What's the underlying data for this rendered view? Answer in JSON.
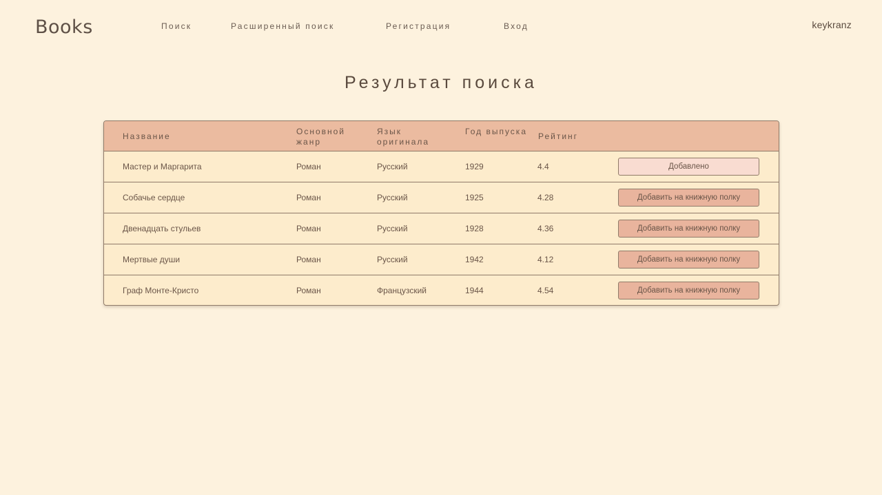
{
  "header": {
    "logo": "Books",
    "nav": {
      "search": "Поиск",
      "advanced_search": "Расширенный поиск",
      "register": "Регистрация",
      "login": "Вход"
    },
    "user": "keykranz"
  },
  "main": {
    "title": "Результат поиска"
  },
  "table": {
    "columns": {
      "name": "Название",
      "genre": "Основной жанр",
      "language": "Язык оригинала",
      "year": "Год выпуска",
      "rating": "Рейтинг"
    },
    "rows": [
      {
        "name": "Мастер и Маргарита",
        "genre": "Роман",
        "language": "Русский",
        "year": "1929",
        "rating": "4.4",
        "action": "Добавлено",
        "added": true
      },
      {
        "name": "Собачье сердце",
        "genre": "Роман",
        "language": "Русский",
        "year": "1925",
        "rating": "4.28",
        "action": "Добавить на книжную полку",
        "added": false
      },
      {
        "name": "Двенадцать стульев",
        "genre": "Роман",
        "language": "Русский",
        "year": "1928",
        "rating": "4.36",
        "action": "Добавить на книжную полку",
        "added": false
      },
      {
        "name": "Мертвые души",
        "genre": "Роман",
        "language": "Русский",
        "year": "1942",
        "rating": "4.12",
        "action": "Добавить на книжную полку",
        "added": false
      },
      {
        "name": "Граф Монте-Кристо",
        "genre": "Роман",
        "language": "Французский",
        "year": "1944",
        "rating": "4.54",
        "action": "Добавить на книжную полку",
        "added": false
      }
    ]
  },
  "colors": {
    "background": "#fdf2de",
    "table_header": "#ebbba0",
    "table_body": "#fdeccc",
    "button": "#e9b49d",
    "button_added": "#f9dcd1",
    "text": "#5a4a3e"
  }
}
